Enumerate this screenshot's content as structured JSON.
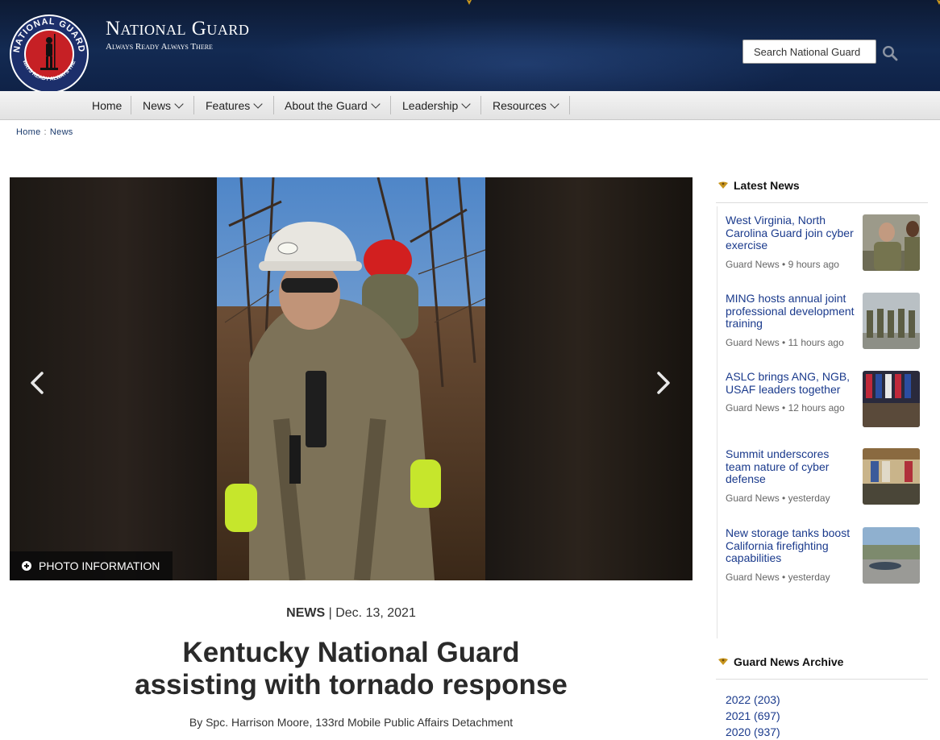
{
  "header": {
    "title": "National Guard",
    "tagline": "Always Ready Always There",
    "logo_text_top": "NATIONAL GUARD",
    "logo_text_bottom": "ALWAYS READY ALWAYS THERE",
    "search_placeholder": "Search National Guard",
    "search_icon": "search-icon"
  },
  "nav": {
    "items": [
      {
        "label": "Home",
        "dropdown": false
      },
      {
        "label": "News",
        "dropdown": true
      },
      {
        "label": "Features",
        "dropdown": true
      },
      {
        "label": "About the Guard",
        "dropdown": true
      },
      {
        "label": "Leadership",
        "dropdown": true
      },
      {
        "label": "Resources",
        "dropdown": true
      }
    ]
  },
  "breadcrumb": [
    "Home",
    "News"
  ],
  "hero": {
    "photo_info_label": "PHOTO INFORMATION",
    "prev_icon": "chevron-left-icon",
    "next_icon": "chevron-right-icon"
  },
  "article": {
    "category": "NEWS",
    "date": "Dec. 13, 2021",
    "headline_line1": "Kentucky National Guard",
    "headline_line2": "assisting with tornado response",
    "byline": "By Spc. Harrison Moore, 133rd Mobile Public Affairs Detachment"
  },
  "sidebar": {
    "latest_heading": "Latest News",
    "latest": [
      {
        "title": "West Virginia, North Carolina Guard join cyber exercise",
        "source": "Guard News",
        "time": "9 hours ago"
      },
      {
        "title": "MING hosts annual joint professional development training",
        "source": "Guard News",
        "time": "11 hours ago"
      },
      {
        "title": "ASLC brings ANG, NGB, USAF leaders together",
        "source": "Guard News",
        "time": "12 hours ago"
      },
      {
        "title": "Summit underscores team nature of cyber defense",
        "source": "Guard News",
        "time": "yesterday"
      },
      {
        "title": "New storage tanks boost California firefighting capabilities",
        "source": "Guard News",
        "time": "yesterday"
      }
    ],
    "archive_heading": "Guard News Archive",
    "archive": [
      "2022 (203)",
      "2021 (697)",
      "2020 (937)"
    ]
  },
  "colors": {
    "header_bg": "#132a52",
    "link": "#1a3a8c",
    "accent_gold": "#c8961e"
  }
}
